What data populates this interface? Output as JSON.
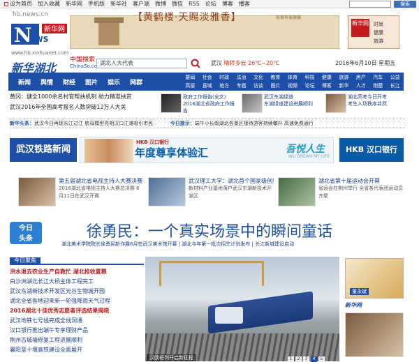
{
  "topbar": {
    "items": [
      "设为首页",
      "加入收藏",
      "新华网",
      "手机版",
      "新华社",
      "客户端",
      "微博",
      "微信",
      "RSS",
      "论坛",
      "博客",
      "播客",
      "新华视频",
      "会员中心"
    ],
    "search_placeholder": "",
    "search_button": "搜索"
  },
  "header": {
    "site_url": "hb.news.cn",
    "logo_alt": "新华网",
    "logo_sub": "www.hb.xinhuanet.com",
    "banner_text": "【黄鹤楼·天赐淡雅香】",
    "banner_small": "吸烟有害健康",
    "stamp_text": "新华网",
    "stamp_lines": [
      "时尚",
      "健康",
      "旅游"
    ],
    "region_title": "新华湖北",
    "search_brand": "中国搜索",
    "search_brand_sub": "ChinaSo.com",
    "search_value": "湖北人大代表",
    "weather_label": "武汉",
    "weather_text": "晴转多云 26℃~20℃",
    "date": "2016年6月10日 星期五"
  },
  "nav": {
    "main": [
      "新闻",
      "舆情",
      "财经",
      "图片",
      "娱乐",
      "网群"
    ],
    "sub": [
      "要闻",
      "社会",
      "时政",
      "法治",
      "文化",
      "教育",
      "体育",
      "科技",
      "健康",
      "旅游",
      "房产",
      "汽车",
      "公益",
      "高层",
      "县域",
      "地方",
      "专题",
      "访谈",
      "图片",
      "视频",
      "论坛",
      "博客",
      "新华",
      "人才",
      "荆楚",
      "长江"
    ]
  },
  "news_left": [
    "黄冈：健全1000余名村官帮扶机制 助力精准扶贫",
    "武汉2016年全国高考报名人数突破12万人大关"
  ],
  "thumbs": [
    {
      "title": "政府工作报告(全文)",
      "desc": "2016湖北省政府工作报告"
    },
    {
      "title": "武汉东湖绿道",
      "desc": "东湖绿道建设进展顺利"
    },
    {
      "title": "湖北高考今日开考",
      "desc": "考生入场秩序井然"
    }
  ],
  "ticker": {
    "label_left": "新华头条：",
    "text_left": "武汉今日再现长江过江 航母模型亮相汉口江滩吸引市民",
    "label_right": "今日提示：",
    "text_right": "端午小长假湖北各景区接待游客持续攀升 高速免费通行"
  },
  "ad_strip": {
    "left": "武汉铁路新闻",
    "hkb": "HKB 汉口银行",
    "slogan": "年度尊享体验汇",
    "life": "吾悦人生",
    "life_sub": "WU DREAM MY LIFE",
    "right": "HKB 汉口银行"
  },
  "promo_cards": [
    {
      "title": "第五届湖北省电视主持人大赛决赛",
      "body": "2016湖北省电视主持人大赛总决赛 6月11日在武汉开赛"
    },
    {
      "title": "武汉理工大学：湖北首个国家级创新中心",
      "body": "新材料产业基地落户武汉东湖新技术开发区"
    },
    {
      "title": "湖北省第十届运动会开幕",
      "body": "省运会在荆州举行 全省各代表团运动员齐聚"
    }
  ],
  "headline": {
    "badge": [
      "今日",
      "头条"
    ],
    "title": "徐勇民：一个真实场景中的瞬间童话",
    "sub": "湖北美术学院院长徐勇民新作展6月在武汉美术馆开幕 | 湖北今年第一批次招生计划发布 | 长江新城建设启动"
  },
  "section_tab": "今日聚焦",
  "bottom_news": [
    {
      "text": "洪水退去农业生产自救忙 湖北抢收夏粮",
      "hot": true
    },
    {
      "text": "白沙洲湖北长江大桥主体工程完工",
      "hot": false
    },
    {
      "text": "武汉东湖新技术开发区光谷生物城开园",
      "hot": false
    },
    {
      "text": "湖北全省各地迎来新一轮强降雨天气过程",
      "hot": false
    },
    {
      "text": "2016湖北十佳优秀志愿者评选结果揭晓",
      "hot": true
    },
    {
      "text": "武汉地铁七号线完成全线洞通",
      "hot": false
    },
    {
      "text": "汉口银行推出端午专享理财产品",
      "hot": false
    },
    {
      "text": "荆州古城墙修复工程进展顺利",
      "hot": false
    },
    {
      "text": "襄阳至十堰高铁建设全面展开",
      "hot": false
    }
  ],
  "photo": {
    "caption": "汉欧班列开启新征程",
    "pages": [
      "1",
      "2",
      "3",
      "4",
      "5"
    ],
    "active_page": 4
  },
  "right_ad": {
    "name": "董永斌",
    "logo": "新华网"
  },
  "colors": {
    "brand_blue": "#1d4fa6",
    "accent_red": "#c41c1c",
    "badge_blue": "#2c7fd2"
  }
}
